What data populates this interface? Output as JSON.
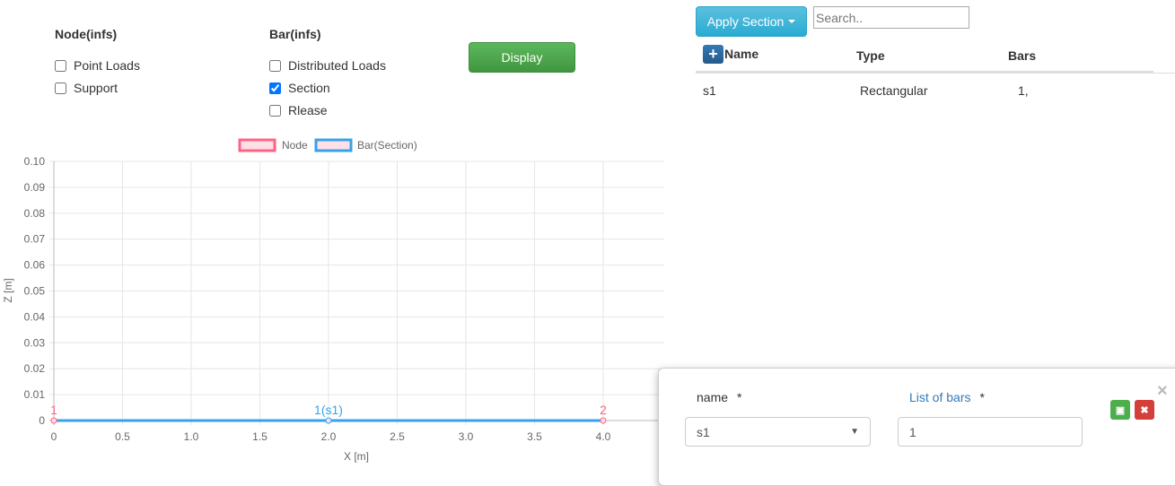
{
  "filters": {
    "node_title": "Node(infs)",
    "node_options": [
      {
        "label": "Point Loads",
        "checked": false
      },
      {
        "label": "Support",
        "checked": false
      }
    ],
    "bar_title": "Bar(infs)",
    "bar_options": [
      {
        "label": "Distributed Loads",
        "checked": false
      },
      {
        "label": "Section",
        "checked": true
      },
      {
        "label": "Rlease",
        "checked": false
      }
    ],
    "display_label": "Display"
  },
  "toolbar": {
    "apply_label": "Apply Section",
    "search_placeholder": "Search.."
  },
  "table": {
    "add_icon": "+",
    "headers": [
      "Name",
      "Type",
      "Bars"
    ],
    "rows": [
      [
        "s1",
        "Rectangular",
        "1,"
      ]
    ]
  },
  "modal": {
    "name_label": "name",
    "required": "*",
    "bars_label": "List of bars",
    "name_value": "s1",
    "bars_value": "1",
    "close": "×",
    "save_icon": "save-icon",
    "cancel_icon": "cancel-icon"
  },
  "colors": {
    "node": "#ff6384",
    "bar": "#36a2eb",
    "link": "#337ab7"
  },
  "chart_data": {
    "type": "line",
    "legend": [
      "Node",
      "Bar(Section)"
    ],
    "legend_placement": "top",
    "xlabel": "X [m]",
    "ylabel": "Z [m]",
    "xlim": [
      0,
      4.4
    ],
    "ylim": [
      0,
      0.1
    ],
    "xticks": [
      "0",
      "0.5",
      "1.0",
      "1.5",
      "2.0",
      "2.5",
      "3.0",
      "3.5",
      "4.0",
      "4"
    ],
    "yticks": [
      "0",
      "0.01",
      "0.02",
      "0.03",
      "0.04",
      "0.05",
      "0.06",
      "0.07",
      "0.08",
      "0.09",
      "0.10"
    ],
    "nodes": [
      {
        "label": "1",
        "x": 0,
        "z": 0
      },
      {
        "label": "2",
        "x": 4,
        "z": 0
      }
    ],
    "bars": [
      {
        "label": "1(s1)",
        "x1": 0,
        "x2": 4,
        "z": 0
      }
    ]
  }
}
